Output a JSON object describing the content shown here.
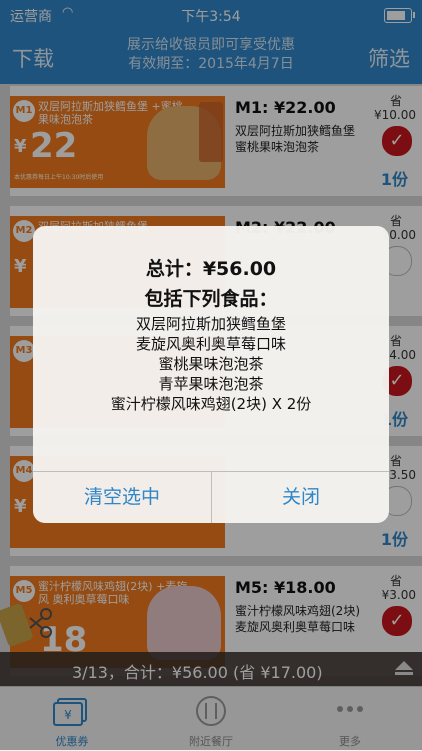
{
  "status": {
    "carrier": "运营商",
    "time": "下午3:54"
  },
  "nav": {
    "left": "下载",
    "right": "筛选",
    "center_line1": "展示给收银员即可享受优惠",
    "center_line2": "有效期至：2015年4月7日"
  },
  "rows": [
    {
      "badge": "M1",
      "coupon_title": "双层阿拉斯加狭鳕鱼堡 +蜜桃果味泡泡茶",
      "coupon_price": "22",
      "title": "M1: ¥22.00",
      "desc": "双层阿拉斯加狭鳕鱼堡 蜜桃果味泡泡茶",
      "save_label": "省",
      "save": "¥10.00",
      "checked": true,
      "portion": "1份"
    },
    {
      "badge": "M2",
      "coupon_title": "双层阿拉斯加狭鳕鱼堡",
      "coupon_price": "",
      "title": "M2: ¥22.00",
      "desc": "",
      "save_label": "省",
      "save": "10.00",
      "checked": false,
      "portion": ""
    },
    {
      "badge": "M3",
      "coupon_title": "",
      "coupon_price": "",
      "title": "",
      "desc": "",
      "save_label": "省",
      "save": "4.00",
      "checked": true,
      "portion": "1份"
    },
    {
      "badge": "M4",
      "coupon_title": "",
      "coupon_price": "",
      "title": "",
      "desc": "",
      "save_label": "省",
      "save": "3.50",
      "checked": false,
      "portion": "1份"
    },
    {
      "badge": "M5",
      "coupon_title": "蜜汁柠檬风味鸡翅(2块) +麦旋风 奥利奥草莓口味",
      "coupon_price": "18",
      "title": "M5: ¥18.00",
      "desc": "蜜汁柠檬风味鸡翅(2块) 麦旋风奥利奥草莓口味",
      "save_label": "省",
      "save": "¥3.00",
      "checked": true,
      "portion": ""
    }
  ],
  "coupon_note": "本优惠券每日上午10:30时后使用",
  "summary": "3/13，合计：¥56.00 (省 ¥17.00)",
  "tabs": [
    {
      "label": "优惠券",
      "icon": "coupon-icon",
      "active": true
    },
    {
      "label": "附近餐厅",
      "icon": "fork-knife-icon",
      "active": false
    },
    {
      "label": "更多",
      "icon": "more-dots-icon",
      "active": false
    }
  ],
  "alert": {
    "title": "总计：¥56.00",
    "subtitle": "包括下列食品：",
    "items": [
      "双层阿拉斯加狭鳕鱼堡",
      "麦旋风奥利奥草莓口味",
      "蜜桃果味泡泡茶",
      "青苹果味泡泡茶",
      "蜜汁柠檬风味鸡翅(2块) X 2份"
    ],
    "clear_button": "清空选中",
    "close_button": "关闭"
  },
  "colors": {
    "accent": "#2f86c8",
    "coupon": "#f07a1e",
    "check": "#c8161e"
  }
}
